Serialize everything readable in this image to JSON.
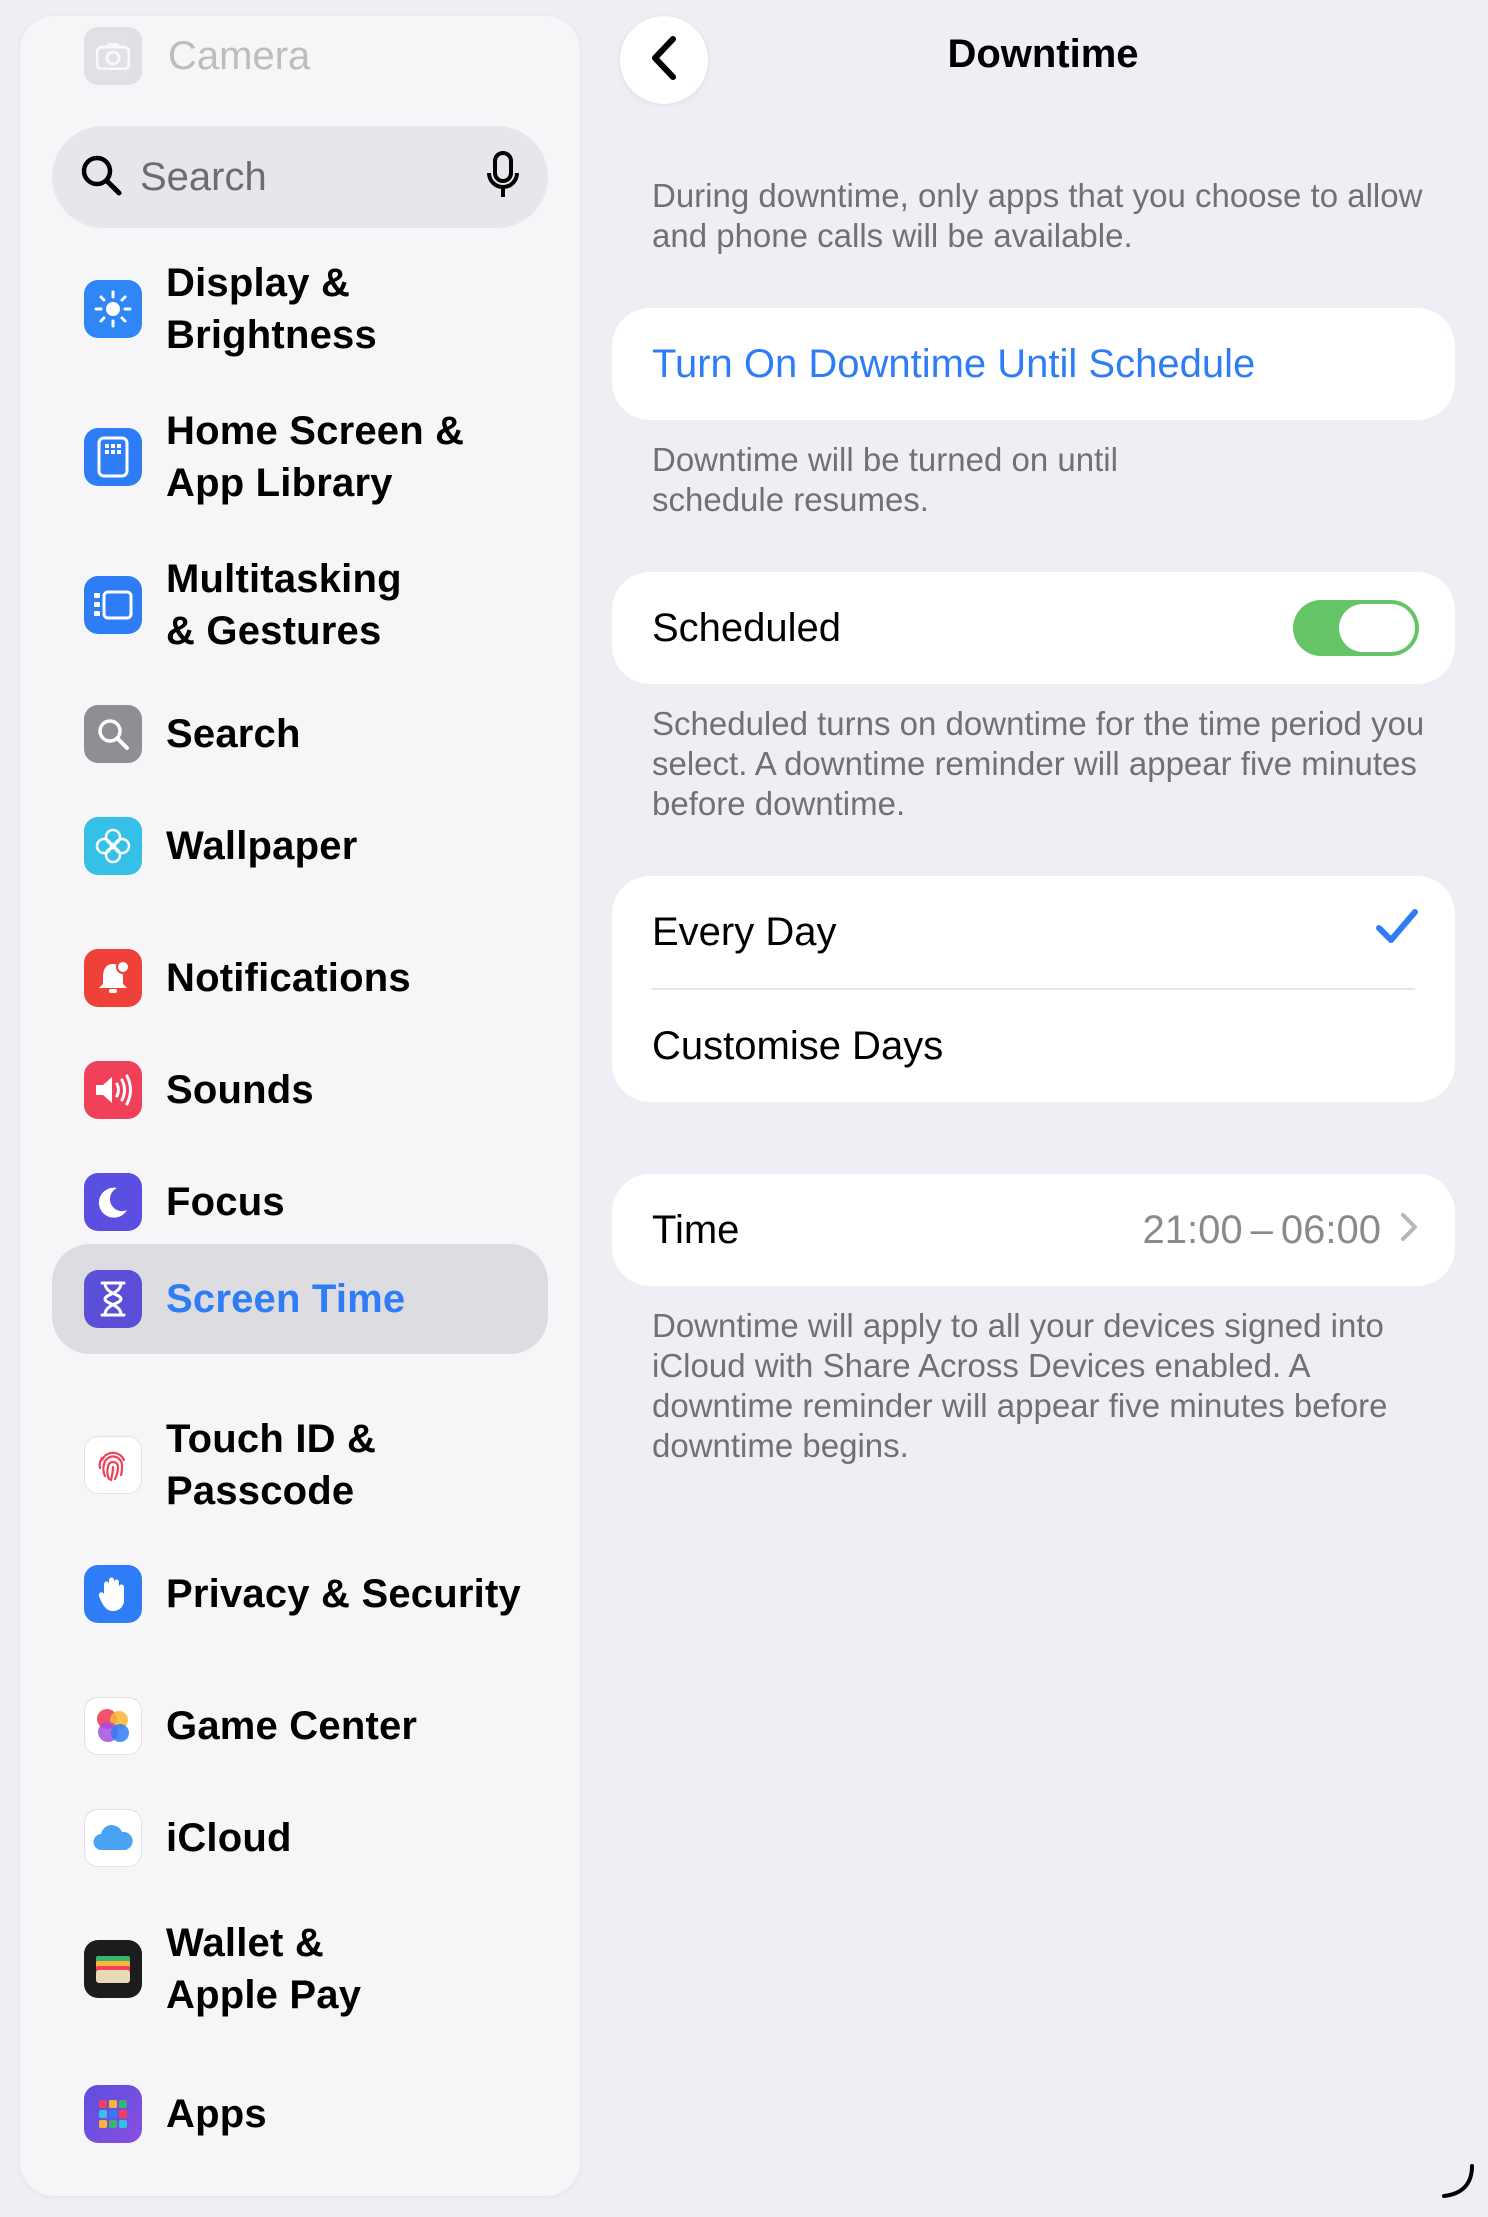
{
  "sidebar": {
    "top_faded_item": "Camera",
    "search_placeholder": "Search",
    "items": [
      {
        "label_lines": [
          "Display &",
          "Brightness"
        ],
        "icon": "sun-icon",
        "color": "#2f86f6"
      },
      {
        "label_lines": [
          "Home Screen &",
          "App Library"
        ],
        "icon": "home-screen-icon",
        "color": "#2f7df6"
      },
      {
        "label_lines": [
          "Multitasking",
          "& Gestures"
        ],
        "icon": "multitasking-icon",
        "color": "#2f7df6"
      },
      {
        "label_lines": [
          "Search"
        ],
        "icon": "magnifier-icon",
        "color": "#8e8e93"
      },
      {
        "label_lines": [
          "Wallpaper"
        ],
        "icon": "flower-icon",
        "color": "#35c0e8"
      },
      {
        "label_lines": [
          "Notifications"
        ],
        "icon": "bell-icon",
        "color": "#f0403a"
      },
      {
        "label_lines": [
          "Sounds"
        ],
        "icon": "speaker-icon",
        "color": "#f0405a"
      },
      {
        "label_lines": [
          "Focus"
        ],
        "icon": "moon-icon",
        "color": "#5a4fe0"
      },
      {
        "label_lines": [
          "Screen Time"
        ],
        "icon": "hourglass-icon",
        "color": "#5b4fd8"
      },
      {
        "label_lines": [
          "Touch ID &",
          "Passcode"
        ],
        "icon": "fingerprint-icon",
        "color": "#ffffff"
      },
      {
        "label_lines": [
          "Privacy & Security"
        ],
        "icon": "hand-icon",
        "color": "#2f7df6"
      },
      {
        "label_lines": [
          "Game Center"
        ],
        "icon": "game-center-icon",
        "color": "#ffffff"
      },
      {
        "label_lines": [
          "iCloud"
        ],
        "icon": "cloud-icon",
        "color": "#ffffff"
      },
      {
        "label_lines": [
          "Wallet &",
          "Apple Pay"
        ],
        "icon": "wallet-icon",
        "color": "#1c1c1e"
      },
      {
        "label_lines": [
          "Apps"
        ],
        "icon": "apps-grid-icon",
        "color": "#5a4fe0"
      }
    ],
    "selected_item": "Screen Time"
  },
  "detail": {
    "title": "Downtime",
    "intro": "During downtime, only apps that you choose to allow and phone calls will be available.",
    "turn_on_label": "Turn On Downtime Until Schedule",
    "turn_on_footnote": "Downtime will be turned on until schedule resumes.",
    "scheduled_label": "Scheduled",
    "scheduled_on": true,
    "scheduled_footnote": "Scheduled turns on downtime for the time period you select. A downtime reminder will appear five minutes before downtime.",
    "day_options": [
      {
        "label": "Every Day",
        "checked": true
      },
      {
        "label": "Customise Days",
        "checked": false
      }
    ],
    "time_label": "Time",
    "time_value": "21:00 – 06:00",
    "time_footnote": "Downtime will apply to all your devices signed into iCloud with Share Across Devices enabled. A downtime reminder will appear five minutes before downtime begins.",
    "accent_color": "#2f7df6",
    "toggle_color": "#65c466"
  }
}
